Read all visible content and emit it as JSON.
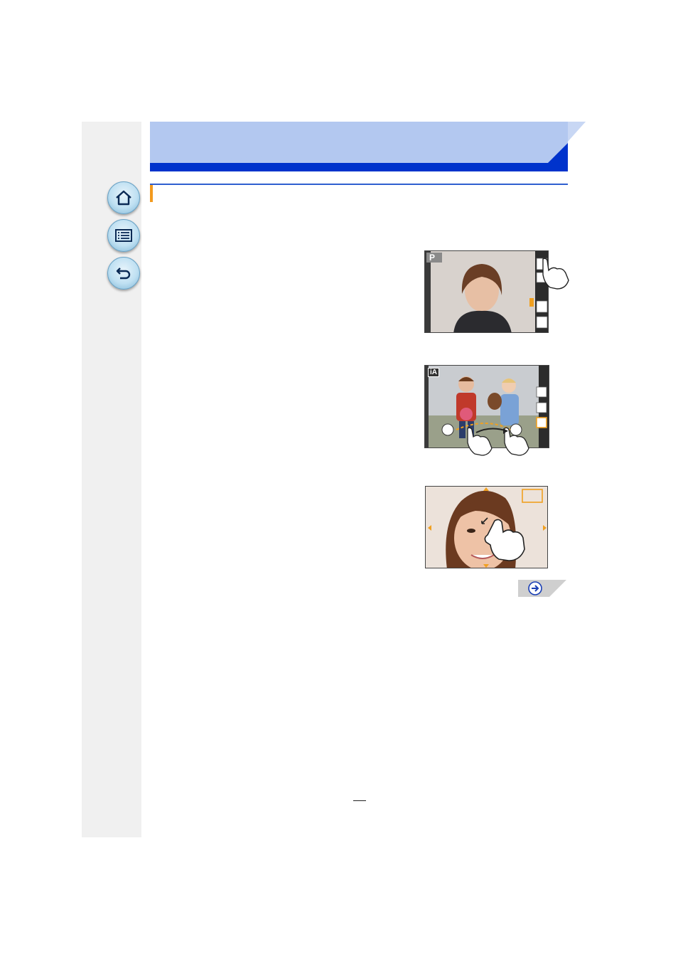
{
  "navigation": {
    "home_icon": "home-icon",
    "menu_icon": "list-menu-icon",
    "back_icon": "return-arrow-icon"
  },
  "header": {
    "banner_light": "#b3c8f0",
    "banner_dark": "#0033cc"
  },
  "section": {
    "accent": "#f39a1e",
    "rule": "#2f5fd0"
  },
  "illustrations": [
    {
      "mode_label": "P",
      "description_icons": [
        "touch-tab-icon",
        "hand-pointer-icon",
        "focus-icon",
        "flash-icon"
      ]
    },
    {
      "mode_label": "iA",
      "description_icons": [
        "slider-icon",
        "hand-drag-icon"
      ]
    },
    {
      "mode_label": "",
      "description_icons": [
        "af-area-frame-icon",
        "pinch-hand-icon"
      ]
    }
  ],
  "next_page": {
    "icon": "next-arrow-icon"
  }
}
